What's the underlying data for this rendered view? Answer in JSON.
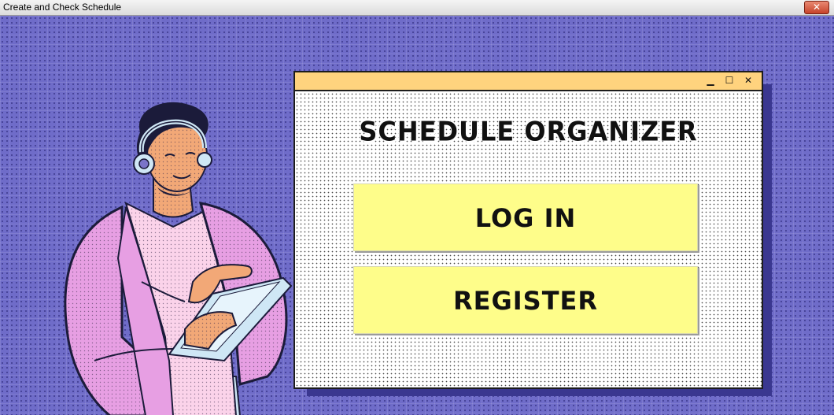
{
  "window": {
    "title": "Create and Check Schedule",
    "close_label": "✕"
  },
  "panel": {
    "title": "SCHEDULE ORGANIZER",
    "minimize_label": "▁",
    "maximize_label": "☐",
    "close_label": "✕"
  },
  "buttons": {
    "login_label": "LOG IN",
    "register_label": "REGISTER"
  },
  "colors": {
    "background": "#6f6cc9",
    "panel_header": "#ffd37e",
    "button": "#fefd8a",
    "jacket": "#e79fe3",
    "skin": "#f2a877"
  }
}
